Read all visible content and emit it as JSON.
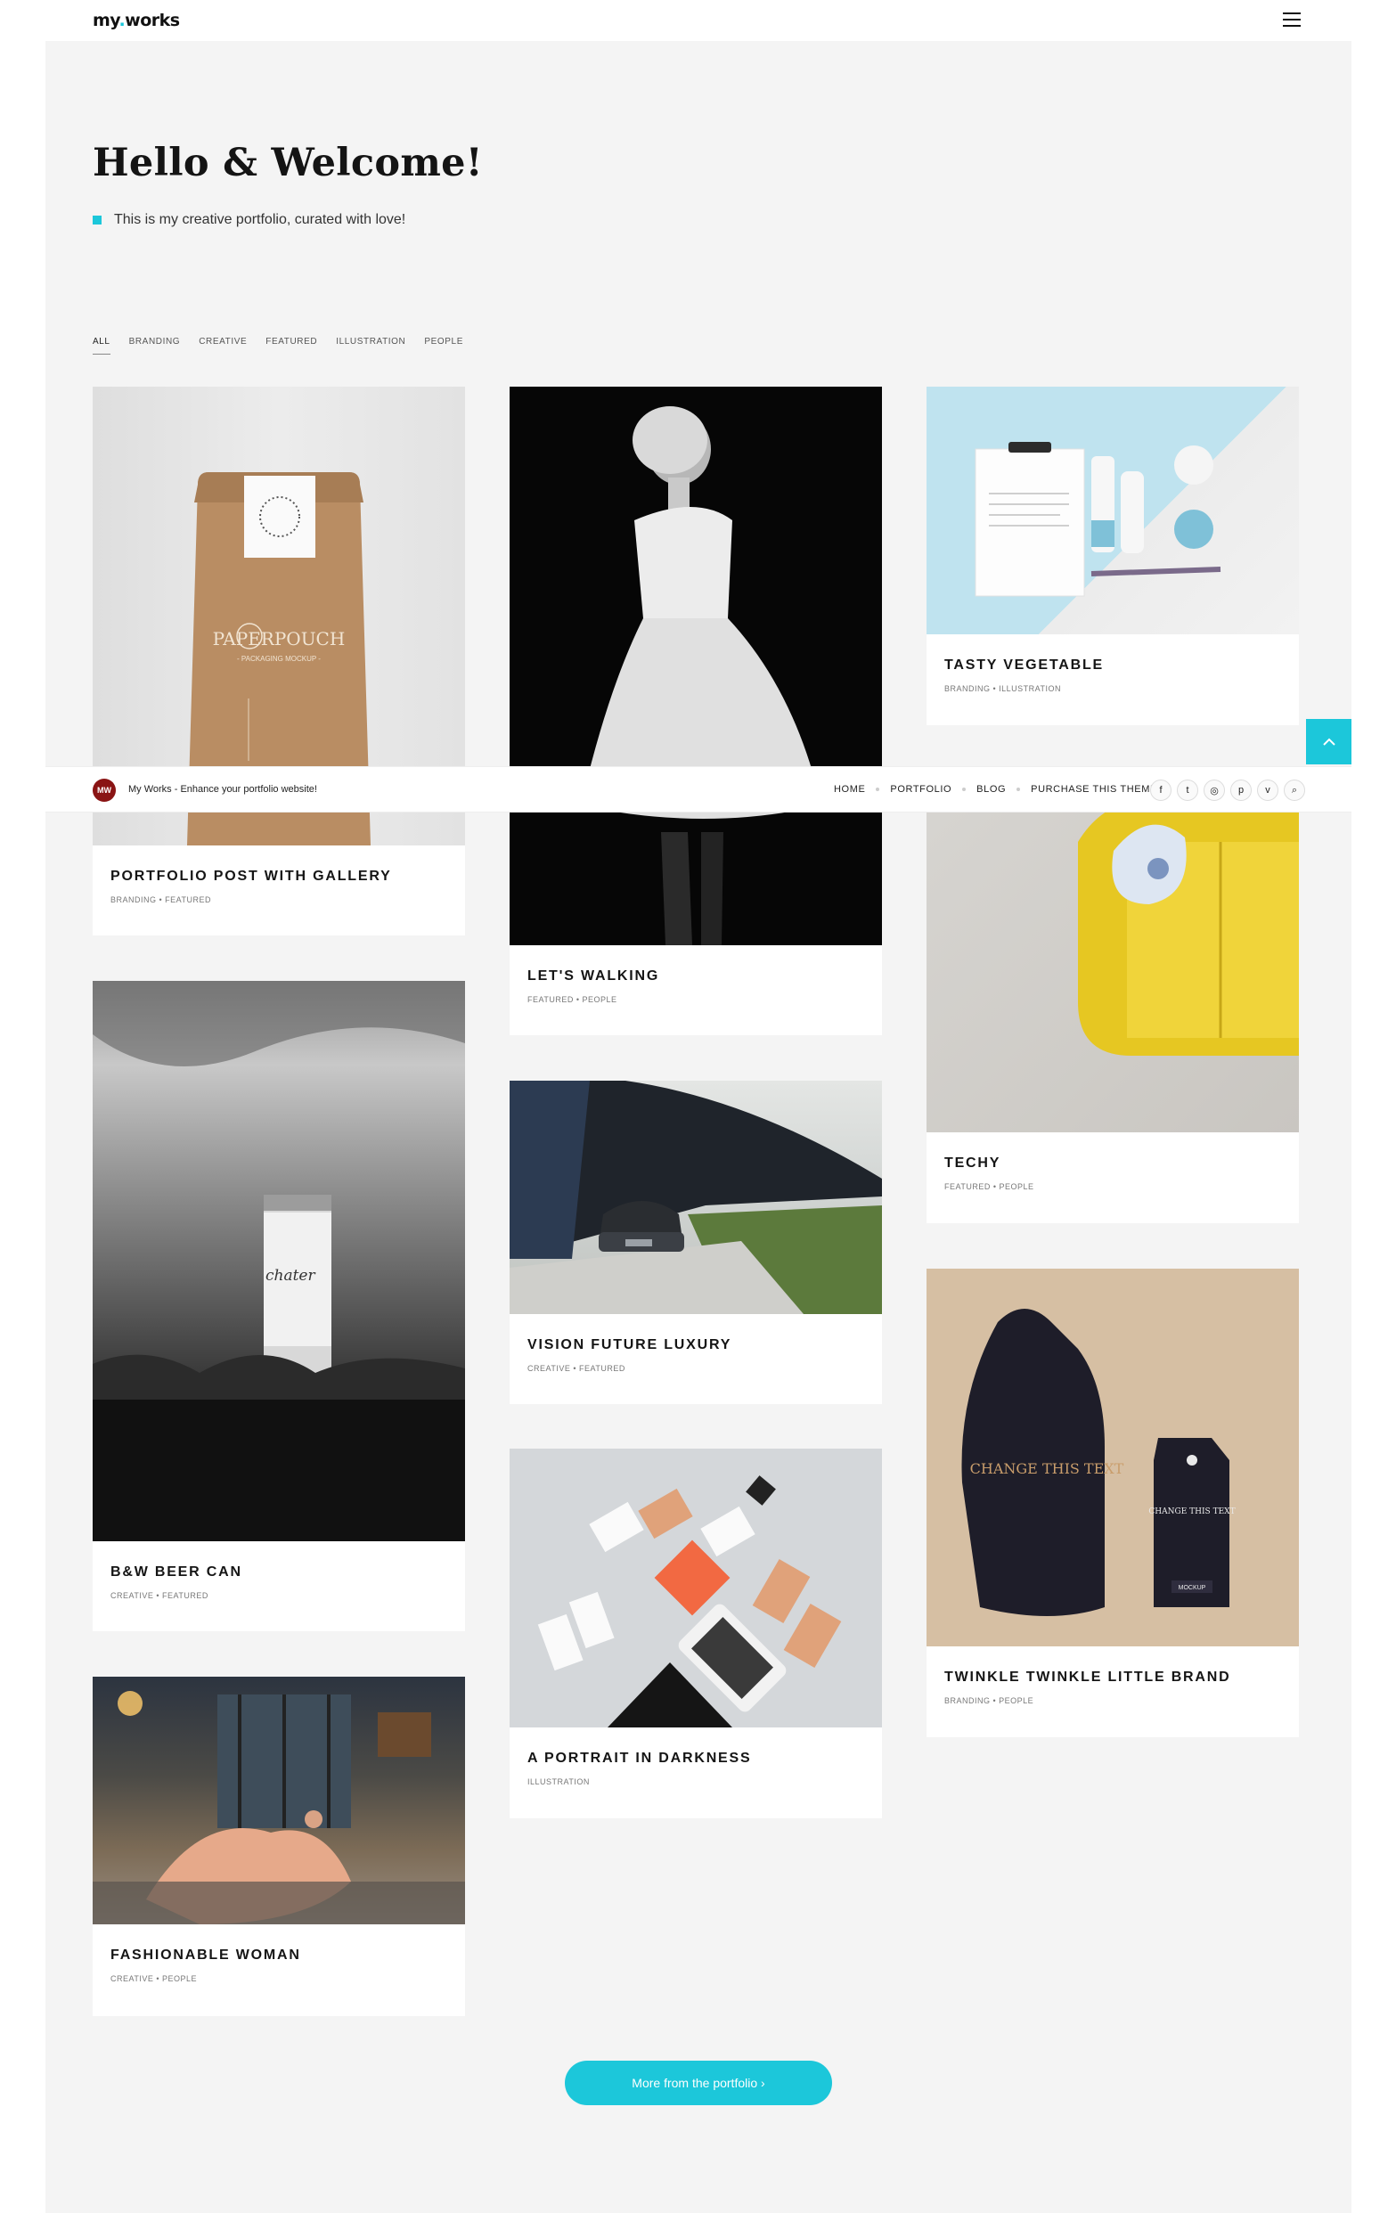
{
  "header": {
    "logo_main": "my",
    "logo_dot": ".",
    "logo_rest": "works"
  },
  "hero": {
    "title": "Hello & Welcome!",
    "subtitle": "This is my creative portfolio, curated with love!"
  },
  "filters": [
    "ALL",
    "BRANDING",
    "CREATIVE",
    "FEATURED",
    "ILLUSTRATION",
    "PEOPLE"
  ],
  "cards": [
    {
      "title": "Portfolio Post With Gallery",
      "cats": "BRANDING • FEATURED"
    },
    {
      "title": "Let's Walking",
      "cats": "FEATURED • PEOPLE"
    },
    {
      "title": "Tasty Vegetable",
      "cats": "BRANDING • ILLUSTRATION"
    },
    {
      "title": "B&W Beer Can",
      "cats": "CREATIVE • FEATURED"
    },
    {
      "title": "Vision Future Luxury",
      "cats": "CREATIVE • FEATURED"
    },
    {
      "title": "Techy",
      "cats": "FEATURED • PEOPLE"
    },
    {
      "title": "Fashionable Woman",
      "cats": "CREATIVE • PEOPLE"
    },
    {
      "title": "A Portrait In Darkness",
      "cats": "ILLUSTRATION"
    },
    {
      "title": "Twinkle Twinkle Little Brand",
      "cats": "BRANDING • PEOPLE"
    }
  ],
  "image_text": {
    "pouch_brand": "PAPERPOUCH",
    "pouch_sub": "- PACKAGING MOCKUP -",
    "bag_text": "CHANGE THIS TEXT",
    "tag_text": "CHANGE THIS TEXT",
    "tag_label": "MOCKUP",
    "can_text": "chater"
  },
  "stickybar": {
    "badge": "MW",
    "tagline": "My Works - Enhance your portfolio website!",
    "nav": [
      "HOME",
      "PORTFOLIO",
      "BLOG",
      "PURCHASE THIS THEME"
    ],
    "social_icons": [
      "facebook-icon",
      "twitter-icon",
      "instagram-icon",
      "pinterest-icon",
      "vimeo-icon",
      "search-icon"
    ]
  },
  "more_button": "More from the portfolio ›",
  "colors": {
    "accent": "#1cc7da",
    "panel_bg": "#f4f4f4",
    "badge": "#8a1414"
  }
}
